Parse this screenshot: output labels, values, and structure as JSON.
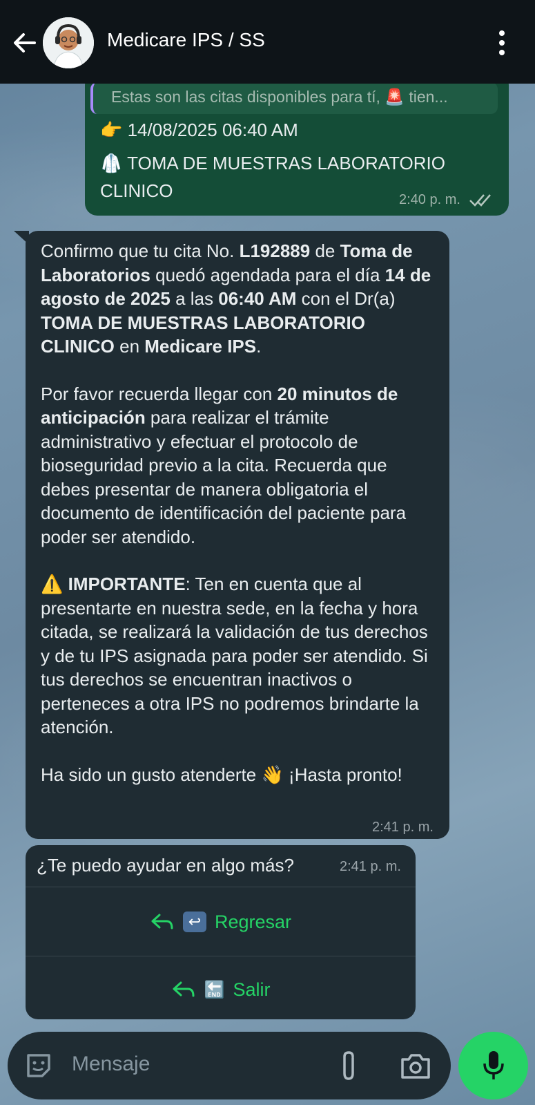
{
  "header": {
    "title": "Medicare IPS / SS"
  },
  "outgoing": {
    "quote_text": "Estas son las citas disponibles para tí, 🚨 tien...",
    "line1": "👉 14/08/2025 06:40 AM",
    "line2": "🥼 TOMA DE MUESTRAS LABORATORIO",
    "line3": "CLINICO",
    "time": "2:40 p. m."
  },
  "incoming": {
    "p1_a": "Confirmo que tu cita No. ",
    "p1_b": "L192889",
    "p1_c": " de ",
    "p1_d": "Toma de Laboratorios",
    "p1_e": " quedó agendada para el día ",
    "p1_f": "14 de agosto de 2025",
    "p1_g": " a las ",
    "p1_h": "06:40 AM",
    "p1_i": " con el Dr(a) ",
    "p1_j": "TOMA DE MUESTRAS LABORATORIO CLINICO",
    "p1_k": " en ",
    "p1_l": "Medicare IPS",
    "p1_m": ".",
    "p2_a": "Por favor recuerda llegar con ",
    "p2_b": "20 minutos de anticipación",
    "p2_c": " para realizar el trámite administrativo y efectuar el protocolo de bioseguridad previo a la cita. Recuerda que debes presentar de manera obligatoria el documento de identificación del paciente para poder ser atendido.",
    "p3_a": "⚠️ ",
    "p3_b": "IMPORTANTE",
    "p3_c": ": Ten en cuenta que al presentarte en nuestra sede, en la fecha y hora citada, se realizará la validación de tus derechos y de tu IPS asignada para poder ser atendido. Si tus derechos se encuentran inactivos o perteneces a otra IPS no podremos brindarte la atención.",
    "p4": "Ha sido un gusto atenderte 👋 ¡Hasta pronto!",
    "time": "2:41 p. m."
  },
  "question": {
    "text": "¿Te puedo ayudar en algo más?",
    "time": "2:41 p. m.",
    "button1_emoji": "↩",
    "button1_label": "Regresar",
    "button2_emoji": "🔚",
    "button2_label": "Salir"
  },
  "input": {
    "placeholder": "Mensaje"
  },
  "colors": {
    "accent": "#25d366",
    "outgoing_bubble": "#144d37",
    "incoming_bubble": "#1f2c33",
    "header": "#0e1418"
  }
}
